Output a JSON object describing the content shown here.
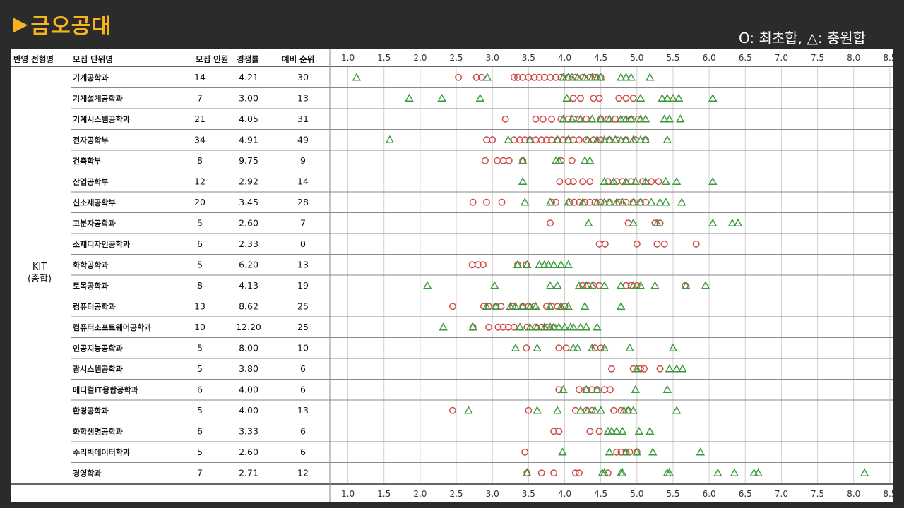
{
  "page": {
    "title": "금오공대",
    "legend_note": "O: 최초합, △: 충원합"
  },
  "colors": {
    "title": "#f5b41e",
    "background": "#2b2b2b",
    "initial_mark": "#d04a4a",
    "additional_mark": "#3a9a3a",
    "grid": "#d0d0d0"
  },
  "chart_data": {
    "type": "scatter",
    "x_ticks": [
      "1.0",
      "1.5",
      "2.0",
      "2.5",
      "3.0",
      "3.5",
      "4.0",
      "4.5",
      "5.0",
      "5.5",
      "6.0",
      "6.5",
      "7.0",
      "7.5",
      "8.0",
      "8.5"
    ],
    "xlim": [
      0.75,
      8.55
    ],
    "grid": true,
    "table_headers": [
      "반영 전형명",
      "모집 단위명",
      "모집 인원",
      "경쟁률",
      "예비 순위"
    ],
    "group_label": "KIT\n(종합)",
    "marker_legend": {
      "circle": "최초합",
      "triangle": "충원합"
    },
    "rows": [
      {
        "name": "기계공학과",
        "recruit": "14",
        "ratio": "4.21",
        "reserve": "30",
        "initial": [
          2.53,
          2.78,
          2.85,
          3.3,
          3.35,
          3.42,
          3.5,
          3.58,
          3.65,
          3.72,
          3.8,
          3.88,
          3.95,
          4.05,
          4.15,
          4.25,
          4.35,
          4.42,
          4.5
        ],
        "additional": [
          1.12,
          2.93,
          3.98,
          4.05,
          4.1,
          4.18,
          4.28,
          4.38,
          4.45,
          4.5,
          4.78,
          4.85,
          4.92,
          5.18
        ]
      },
      {
        "name": "기계설계공학과",
        "recruit": "7",
        "ratio": "3.00",
        "reserve": "13",
        "initial": [
          4.12,
          4.22,
          4.4,
          4.48,
          4.75,
          4.85,
          4.95
        ],
        "additional": [
          1.85,
          2.3,
          2.83,
          4.03,
          5.05,
          5.35,
          5.42,
          5.5,
          5.58,
          6.05
        ]
      },
      {
        "name": "기계시스템공학과",
        "recruit": "21",
        "ratio": "4.05",
        "reserve": "31",
        "initial": [
          3.18,
          3.6,
          3.7,
          3.82,
          3.95,
          4.05,
          4.12,
          4.2,
          4.3,
          4.5,
          4.6,
          4.7,
          4.82,
          4.92,
          5.02
        ],
        "additional": [
          3.98,
          4.1,
          4.22,
          4.38,
          4.5,
          4.62,
          4.78,
          4.85,
          4.92,
          5.05,
          5.12,
          5.38,
          5.45,
          5.6
        ]
      },
      {
        "name": "전자공학부",
        "recruit": "34",
        "ratio": "4.91",
        "reserve": "49",
        "initial": [
          2.92,
          3.0,
          3.3,
          3.38,
          3.45,
          3.52,
          3.6,
          3.68,
          3.75,
          3.82,
          3.9,
          3.98,
          4.05,
          4.12,
          4.2,
          4.3,
          4.4,
          4.5,
          4.62,
          4.72,
          4.85,
          4.98,
          5.12
        ],
        "additional": [
          1.58,
          3.22,
          3.52,
          3.9,
          4.05,
          4.32,
          4.45,
          4.55,
          4.62,
          4.7,
          4.78,
          4.85,
          4.95,
          5.05,
          5.12,
          5.42
        ]
      },
      {
        "name": "건축학부",
        "recruit": "8",
        "ratio": "9.75",
        "reserve": "9",
        "initial": [
          2.9,
          3.07,
          3.15,
          3.23,
          3.42,
          3.95,
          4.1
        ],
        "additional": [
          3.42,
          3.88,
          3.92,
          4.28,
          4.35
        ]
      },
      {
        "name": "산업공학부",
        "recruit": "12",
        "ratio": "2.92",
        "reserve": "14",
        "initial": [
          3.93,
          4.05,
          4.12,
          4.25,
          4.35,
          4.6,
          4.72,
          4.8,
          4.92,
          5.08,
          5.2,
          5.3
        ],
        "additional": [
          3.42,
          4.55,
          4.68,
          4.85,
          4.98,
          5.12,
          5.4,
          5.55,
          6.05
        ]
      },
      {
        "name": "신소재공학부",
        "recruit": "20",
        "ratio": "3.45",
        "reserve": "28",
        "initial": [
          2.73,
          2.92,
          3.13,
          3.82,
          3.88,
          4.07,
          4.13,
          4.2,
          4.28,
          4.35,
          4.42,
          4.5,
          4.62,
          4.75,
          4.85,
          4.95,
          5.05,
          5.12
        ],
        "additional": [
          3.45,
          3.8,
          4.05,
          4.25,
          4.45,
          4.55,
          4.62,
          4.72,
          4.8,
          4.95,
          5.05,
          5.2,
          5.32,
          5.4,
          5.62
        ]
      },
      {
        "name": "고분자공학과",
        "recruit": "5",
        "ratio": "2.60",
        "reserve": "7",
        "initial": [
          3.8,
          4.88,
          5.25,
          5.32
        ],
        "additional": [
          4.33,
          4.95,
          5.28,
          6.05,
          6.32,
          6.4
        ]
      },
      {
        "name": "소재디자인공학과",
        "recruit": "6",
        "ratio": "2.33",
        "reserve": "0",
        "initial": [
          4.48,
          4.56,
          5.0,
          5.28,
          5.38,
          5.82
        ],
        "additional": []
      },
      {
        "name": "화학공학과",
        "recruit": "5",
        "ratio": "6.20",
        "reserve": "13",
        "initial": [
          2.72,
          2.8,
          2.87,
          3.35,
          3.47
        ],
        "additional": [
          3.35,
          3.48,
          3.65,
          3.72,
          3.78,
          3.85,
          3.95,
          4.05
        ]
      },
      {
        "name": "토목공학과",
        "recruit": "8",
        "ratio": "4.13",
        "reserve": "19",
        "initial": [
          4.25,
          4.32,
          4.4,
          4.48,
          4.85,
          4.92,
          5.0,
          5.67
        ],
        "additional": [
          2.1,
          3.03,
          3.8,
          3.9,
          4.2,
          4.3,
          4.38,
          4.55,
          4.78,
          4.95,
          5.05,
          5.25,
          5.68,
          5.95
        ]
      },
      {
        "name": "컴퓨터공학과",
        "recruit": "13",
        "ratio": "8.62",
        "reserve": "25",
        "initial": [
          2.45,
          2.88,
          2.95,
          3.05,
          3.12,
          3.28,
          3.42,
          3.5,
          3.58,
          3.75,
          3.82,
          3.9,
          4.0
        ],
        "additional": [
          2.92,
          3.05,
          3.25,
          3.32,
          3.42,
          3.52,
          3.6,
          3.8,
          3.95,
          4.05,
          4.28,
          4.78
        ]
      },
      {
        "name": "컴퓨터소프트웨어공학과",
        "recruit": "10",
        "ratio": "12.20",
        "reserve": "25",
        "initial": [
          2.73,
          2.95,
          3.08,
          3.15,
          3.22,
          3.3,
          3.48,
          3.6,
          3.68,
          3.75,
          3.85
        ],
        "additional": [
          2.32,
          2.73,
          3.38,
          3.52,
          3.62,
          3.72,
          3.8,
          3.85,
          3.92,
          4.0,
          4.08,
          4.12,
          4.22,
          4.3,
          4.45
        ]
      },
      {
        "name": "인공지능공학과",
        "recruit": "5",
        "ratio": "8.00",
        "reserve": "10",
        "initial": [
          3.47,
          3.92,
          4.02,
          4.42,
          4.5
        ],
        "additional": [
          3.32,
          3.62,
          4.12,
          4.18,
          4.38,
          4.55,
          4.9,
          5.5
        ]
      },
      {
        "name": "광시스템공학과",
        "recruit": "5",
        "ratio": "3.80",
        "reserve": "6",
        "initial": [
          4.65,
          4.95,
          5.05,
          5.1,
          5.32
        ],
        "additional": [
          5.0,
          5.45,
          5.55,
          5.63
        ]
      },
      {
        "name": "메디컬IT융합공학과",
        "recruit": "6",
        "ratio": "4.00",
        "reserve": "6",
        "initial": [
          3.92,
          4.2,
          4.3,
          4.38,
          4.45,
          4.55,
          4.63
        ],
        "additional": [
          3.98,
          4.3,
          4.45,
          4.98,
          5.42
        ]
      },
      {
        "name": "환경공학과",
        "recruit": "5",
        "ratio": "4.00",
        "reserve": "13",
        "initial": [
          2.45,
          3.5,
          4.15,
          4.3,
          4.38,
          4.68,
          4.78,
          4.88
        ],
        "additional": [
          2.67,
          3.62,
          3.9,
          4.22,
          4.32,
          4.42,
          4.5,
          4.82,
          4.88,
          4.95,
          5.55
        ]
      },
      {
        "name": "화학생명공학과",
        "recruit": "6",
        "ratio": "3.33",
        "reserve": "6",
        "initial": [
          3.85,
          3.92,
          4.35,
          4.48
        ],
        "additional": [
          4.6,
          4.65,
          4.72,
          4.8,
          5.03,
          5.18
        ]
      },
      {
        "name": "수리빅데이터학과",
        "recruit": "5",
        "ratio": "2.60",
        "reserve": "6",
        "initial": [
          3.45,
          4.72,
          4.78,
          4.85,
          4.9,
          5.0
        ],
        "additional": [
          3.97,
          4.62,
          4.85,
          5.0,
          5.22,
          5.88
        ]
      },
      {
        "name": "경영학과",
        "recruit": "7",
        "ratio": "2.71",
        "reserve": "12",
        "initial": [
          3.48,
          3.68,
          3.85,
          4.15,
          4.2,
          4.6
        ],
        "additional": [
          3.48,
          4.52,
          4.55,
          4.78,
          4.8,
          5.42,
          5.45,
          6.12,
          6.35,
          6.62,
          6.68,
          8.15
        ]
      }
    ]
  }
}
